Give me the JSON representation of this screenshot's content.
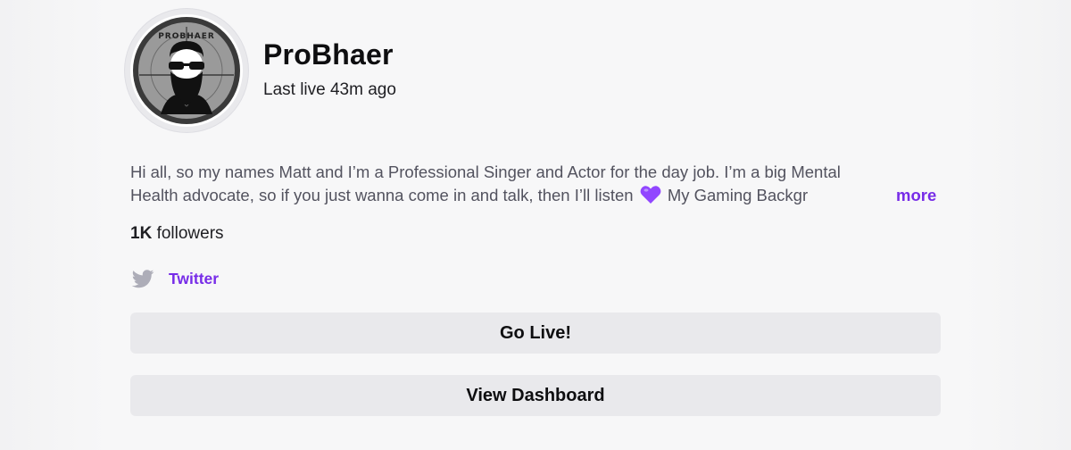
{
  "profile": {
    "channel_name": "ProBhaer",
    "last_live": "Last live 43m ago",
    "avatar_caption": "PROBHAER"
  },
  "bio": {
    "line1": "Hi all, so my names Matt and I’m a Professional Singer and Actor for the day job. I’m a big Mental",
    "line2_before_emoji": "Health advocate, so if you just wanna come in and talk, then I’ll listen ",
    "line2_after_emoji": " My Gaming Backgr",
    "more_label": "more"
  },
  "followers": {
    "count": "1K",
    "label": " followers"
  },
  "social": {
    "twitter_label": "Twitter"
  },
  "actions": {
    "go_live_label": "Go Live!",
    "dashboard_label": "View Dashboard"
  },
  "colors": {
    "accent": "#772ce8",
    "button_bg": "#e9e9ec",
    "page_bg": "#f7f7f8",
    "heart": "#9146ff",
    "twitter_icon": "#adadb8"
  },
  "icons": {
    "avatar": "bearded-man-crosshair-logo",
    "twitter": "twitter-bird-icon",
    "emoji": "purple-heart-emoji"
  }
}
